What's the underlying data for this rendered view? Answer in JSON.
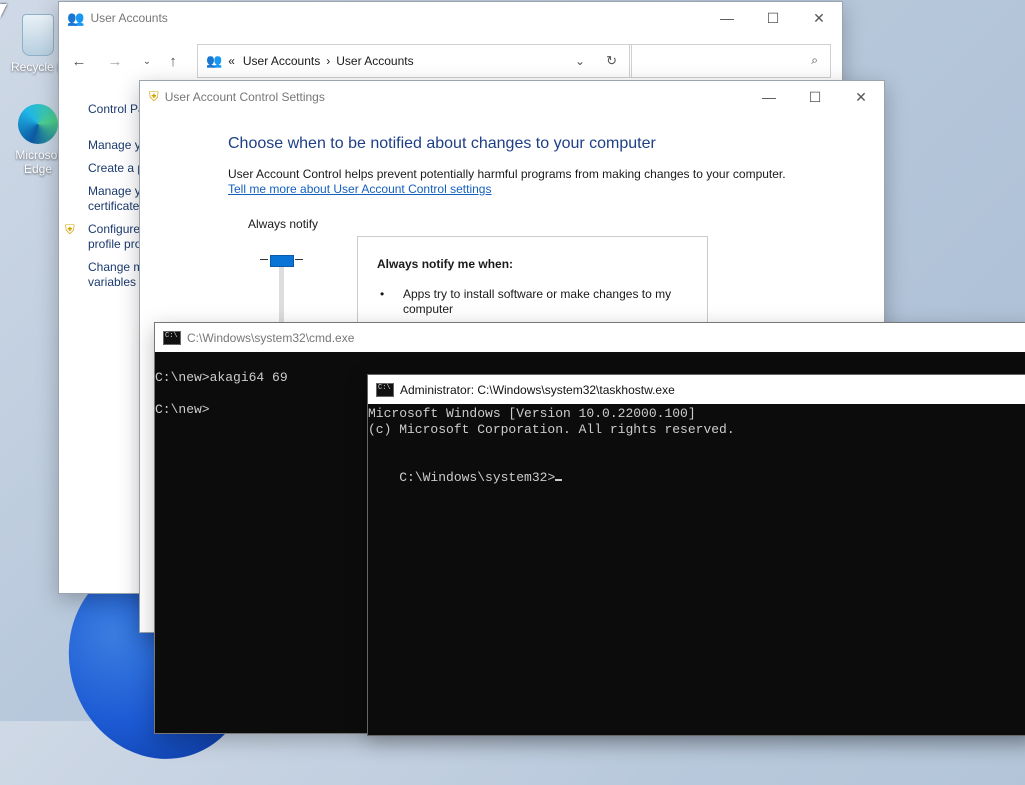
{
  "desktop": {
    "recycle_bin_label": "Recycle B",
    "edge_label_line1": "Microsof",
    "edge_label_line2": "Edge"
  },
  "user_accounts_window": {
    "title": "User Accounts",
    "address": {
      "chevrons": "«",
      "crumb1": "User Accounts",
      "separator": "›",
      "crumb2": "User Accounts"
    },
    "search_placeholder": "",
    "sidebar": {
      "control_panel": "Control Pa",
      "items": [
        {
          "line1": "Manage y",
          "line2": ""
        },
        {
          "line1": "Create a p",
          "line2": ""
        },
        {
          "line1": "Manage y",
          "line2": "certificate"
        },
        {
          "line1": "Configure",
          "line2": "profile pro"
        },
        {
          "line1": "Change m",
          "line2": "variables"
        }
      ]
    }
  },
  "uac_window": {
    "title": "User Account Control Settings",
    "heading": "Choose when to be notified about changes to your computer",
    "description": "User Account Control helps prevent potentially harmful programs from making changes to your computer.",
    "link": "Tell me more about User Account Control settings",
    "slider_top_label": "Always notify",
    "slider_level": "Always notify",
    "info_title": "Always notify me when:",
    "info_bullet_line1": "Apps try to install software or make changes to my",
    "info_bullet_line2": "computer"
  },
  "cmd_window": {
    "title": "C:\\Windows\\system32\\cmd.exe",
    "line1": "C:\\new>akagi64 69",
    "line2": "C:\\new>"
  },
  "taskhost_window": {
    "title": "Administrator: C:\\Windows\\system32\\taskhostw.exe",
    "line1": "Microsoft Windows [Version 10.0.22000.100]",
    "line2": "(c) Microsoft Corporation. All rights reserved.",
    "line3": "C:\\Windows\\system32>"
  },
  "colors": {
    "accent": "#0a74d6",
    "link": "#1460bf",
    "heading": "#1e3f86",
    "console_bg": "#0c0c0c",
    "console_fg": "#cccccc"
  }
}
